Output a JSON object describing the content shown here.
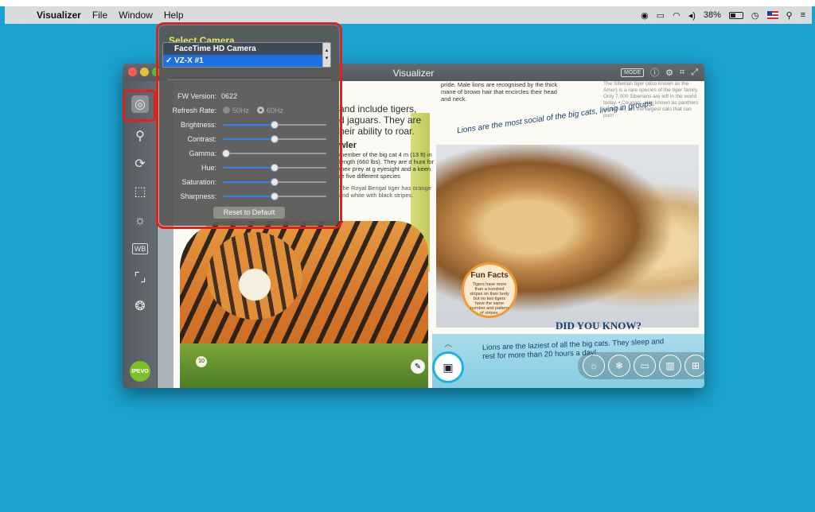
{
  "menubar": {
    "app_name": "Visualizer",
    "items": [
      "File",
      "Window",
      "Help"
    ],
    "battery": "38%"
  },
  "window": {
    "title": "Visualizer",
    "mode_label": "MODE"
  },
  "leftbar": {
    "tools": [
      {
        "name": "camera-settings",
        "icon": "camera-settings-icon"
      },
      {
        "name": "zoom",
        "icon": "magnifier-icon"
      },
      {
        "name": "rotate",
        "icon": "rotate-icon"
      },
      {
        "name": "crop",
        "icon": "crop-icon"
      },
      {
        "name": "brightness",
        "icon": "sun-icon"
      },
      {
        "name": "white-balance",
        "icon": "wb-icon",
        "label": "WB"
      },
      {
        "name": "focus",
        "icon": "focus-icon"
      },
      {
        "name": "color-filter",
        "icon": "color-filter-icon"
      }
    ],
    "logo": "IPEVO"
  },
  "panel": {
    "title": "Select Camera",
    "camera_options": [
      "FaceTime HD Camera",
      "VZ-X #1"
    ],
    "selected_camera": "VZ-X #1",
    "fw_label": "FW Version:",
    "fw_value": "0622",
    "refresh_label": "Refresh Rate:",
    "refresh_options": [
      "50Hz",
      "60Hz"
    ],
    "refresh_selected": "60Hz",
    "sliders": [
      {
        "label": "Brightness:",
        "value": 0.5
      },
      {
        "label": "Contrast:",
        "value": 0.5
      },
      {
        "label": "Gamma:",
        "value": 0.03
      },
      {
        "label": "Hue:",
        "value": 0.5
      },
      {
        "label": "Saturation:",
        "value": 0.5
      },
      {
        "label": "Sharpness:",
        "value": 0.5
      }
    ],
    "reset_label": "Reset to Default"
  },
  "book": {
    "left_text_lines": [
      "and include tigers,",
      "d jaguars. They are",
      "heir ability to roar."
    ],
    "left_heading": "wler",
    "left_body": "member of the big cat 4 m (13 ft) in length (660 lbs). They are d hunt for their prey at g eyesight and a keen re five different species",
    "left_caption": "The Royal Bengal tiger has orange and white with black stripes.",
    "page_number": "10",
    "right_top_text": "pride. Male lions are recognised by the thick mane of brown hair that encircles their head and neck.",
    "right_box_text": "The Siberian tiger (also known as the Amur) is a rare species of the tiger family. Only 7,000 Siberians are left in the world today. • Cougars, also known as panthers or pumas, are the largest cats that can purr!",
    "lions_caption": "Lions are the most social of the big cats, living in groups.",
    "fun_facts_title": "Fun Facts",
    "fun_facts_body": "Tigers have more than a hundred stripes on their body but no two tigers have the same number and pattern of stripes.",
    "did_you_know": "DID YOU KNOW?",
    "lions_text": "Lions are the laziest of all the big cats. They sleep and rest for more than 20 hours a day!"
  },
  "bottom_tools": [
    "brightness-icon",
    "freeze-icon",
    "picture-in-picture-icon",
    "book-icon",
    "split-icon",
    "fullscreen-icon"
  ]
}
